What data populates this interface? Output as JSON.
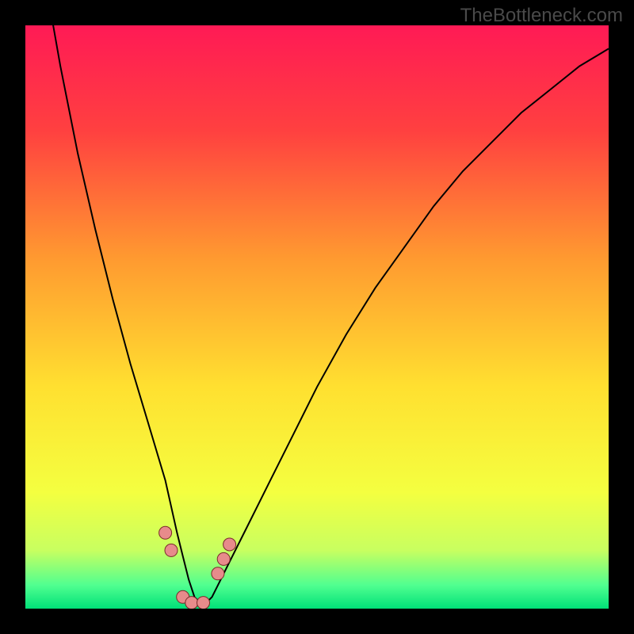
{
  "watermark": "TheBottleneck.com",
  "colors": {
    "gradient": [
      {
        "offset": "0%",
        "hex": "#ff1a55"
      },
      {
        "offset": "18%",
        "hex": "#ff4040"
      },
      {
        "offset": "40%",
        "hex": "#ff9a30"
      },
      {
        "offset": "62%",
        "hex": "#ffe030"
      },
      {
        "offset": "80%",
        "hex": "#f4ff40"
      },
      {
        "offset": "90%",
        "hex": "#c8ff60"
      },
      {
        "offset": "96%",
        "hex": "#50ff90"
      },
      {
        "offset": "100%",
        "hex": "#00e078"
      }
    ],
    "curve": "#000000",
    "marker_fill": "#e78b8b",
    "marker_stroke": "#7a2a2a"
  },
  "chart_data": {
    "type": "line",
    "title": "",
    "xlabel": "",
    "ylabel": "",
    "xlim": [
      0,
      100
    ],
    "ylim": [
      0,
      100
    ],
    "grid": false,
    "note": "x is normalized hardware-balance axis (0-100); y is bottleneck % (0 optimal at bottom, 100 worst at top). Curve is a V with minimum near x≈29. Values estimated from pixel positions.",
    "series": [
      {
        "name": "bottleneck-curve",
        "x": [
          0,
          3,
          6,
          9,
          12,
          15,
          18,
          21,
          24,
          26,
          27,
          28,
          29,
          30,
          31,
          32,
          33,
          35,
          38,
          42,
          46,
          50,
          55,
          60,
          65,
          70,
          75,
          80,
          85,
          90,
          95,
          100
        ],
        "y": [
          130,
          110,
          93,
          78,
          65,
          53,
          42,
          32,
          22,
          13,
          9,
          5,
          2,
          1,
          1,
          2,
          4,
          8,
          14,
          22,
          30,
          38,
          47,
          55,
          62,
          69,
          75,
          80,
          85,
          89,
          93,
          96
        ]
      }
    ],
    "markers": [
      {
        "x": 24.0,
        "y": 13.0
      },
      {
        "x": 25.0,
        "y": 10.0
      },
      {
        "x": 27.0,
        "y": 2.0
      },
      {
        "x": 28.5,
        "y": 1.0
      },
      {
        "x": 30.5,
        "y": 1.0
      },
      {
        "x": 33.0,
        "y": 6.0
      },
      {
        "x": 34.0,
        "y": 8.5
      },
      {
        "x": 35.0,
        "y": 11.0
      }
    ]
  }
}
